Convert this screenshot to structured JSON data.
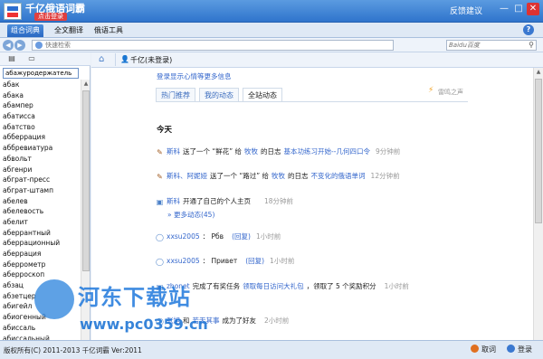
{
  "titlebar": {
    "app_title": "千亿俄语词霸",
    "login_badge": "点击登录",
    "feedback": "反馈建议",
    "min_glyph": "—",
    "max_glyph": "□",
    "close_glyph": "✕"
  },
  "menu": {
    "tabs": [
      "组合词典",
      "全文翻译",
      "俄语工具"
    ],
    "active_index": 0,
    "help_glyph": "?"
  },
  "toolbar": {
    "search_placeholder": "快速检索",
    "right_search_placeholder": "Baidu百度"
  },
  "left": {
    "input_value": "абажуродержатель",
    "words": [
      "абак",
      "абака",
      "абампер",
      "абатисса",
      "абатство",
      "абберрация",
      "аббревиатура",
      "абвольт",
      "абгенри",
      "абграт-пресс",
      "абграт-штамп",
      "абелев",
      "абелевость",
      "абелит",
      "аберрантный",
      "аберрационный",
      "аберрация",
      "аберрометр",
      "аберроскоп",
      "абзац",
      "абзетцер",
      "абигейл",
      "абиогенный",
      "абиссаль",
      "абиссальный"
    ]
  },
  "right_header": {
    "user_label": "千亿(未登录)"
  },
  "content": {
    "login_tip": "登录显示心情等更多信息",
    "tabs": [
      "热门推荐",
      "我的动态",
      "全站动态"
    ],
    "active_tab": 2,
    "side_note": "雷鸣之声",
    "day_label": "今天",
    "feed": [
      {
        "user": "斯科",
        "text1": "送了一个 “鲜花” 给",
        "target": "牧牧",
        "text2": "的日志",
        "link": "基本功练习开始--几何四口令",
        "time": "9分钟前"
      },
      {
        "user": "斯科、阿妮娅",
        "text1": "送了一个 “路过” 给",
        "target": "牧牧",
        "text2": "的日志",
        "link": "不变化的俄语单词",
        "time": "12分钟前"
      },
      {
        "user": "斯科",
        "text1": "开通了自己的个人主页",
        "target": "",
        "text2": "",
        "link": "",
        "time": "18分钟前"
      },
      {
        "user": "xxsu2005",
        "text1": "： Рбв",
        "target": "",
        "text2": "",
        "link": "(回复)",
        "time": "1小时前"
      },
      {
        "user": "xxsu2005",
        "text1": "： Привет",
        "target": "",
        "text2": "",
        "link": "(回复)",
        "time": "1小时前"
      },
      {
        "user": "zhonet",
        "text1": "完成了有奖任务",
        "target": "领取每日访问大礼包",
        "text2": "，领取了 5 个奖励积分",
        "link": "",
        "time": "1小时前"
      },
      {
        "user": "张旭",
        "text1": "和",
        "target": "若无其事",
        "text2": "成为了好友",
        "link": "",
        "time": "2小时前"
      }
    ],
    "more_link": "» 更多动态(45)"
  },
  "status": {
    "copyright": "版权所有(C) 2011-2013 千亿词霸 Ver:2011",
    "btn_lookup": "取词",
    "btn_login": "登录"
  },
  "watermark": {
    "title": "河东下载站",
    "url": "www.pc0359.cn"
  },
  "colors": {
    "accent": "#2f74cc",
    "link": "#3366cc"
  }
}
